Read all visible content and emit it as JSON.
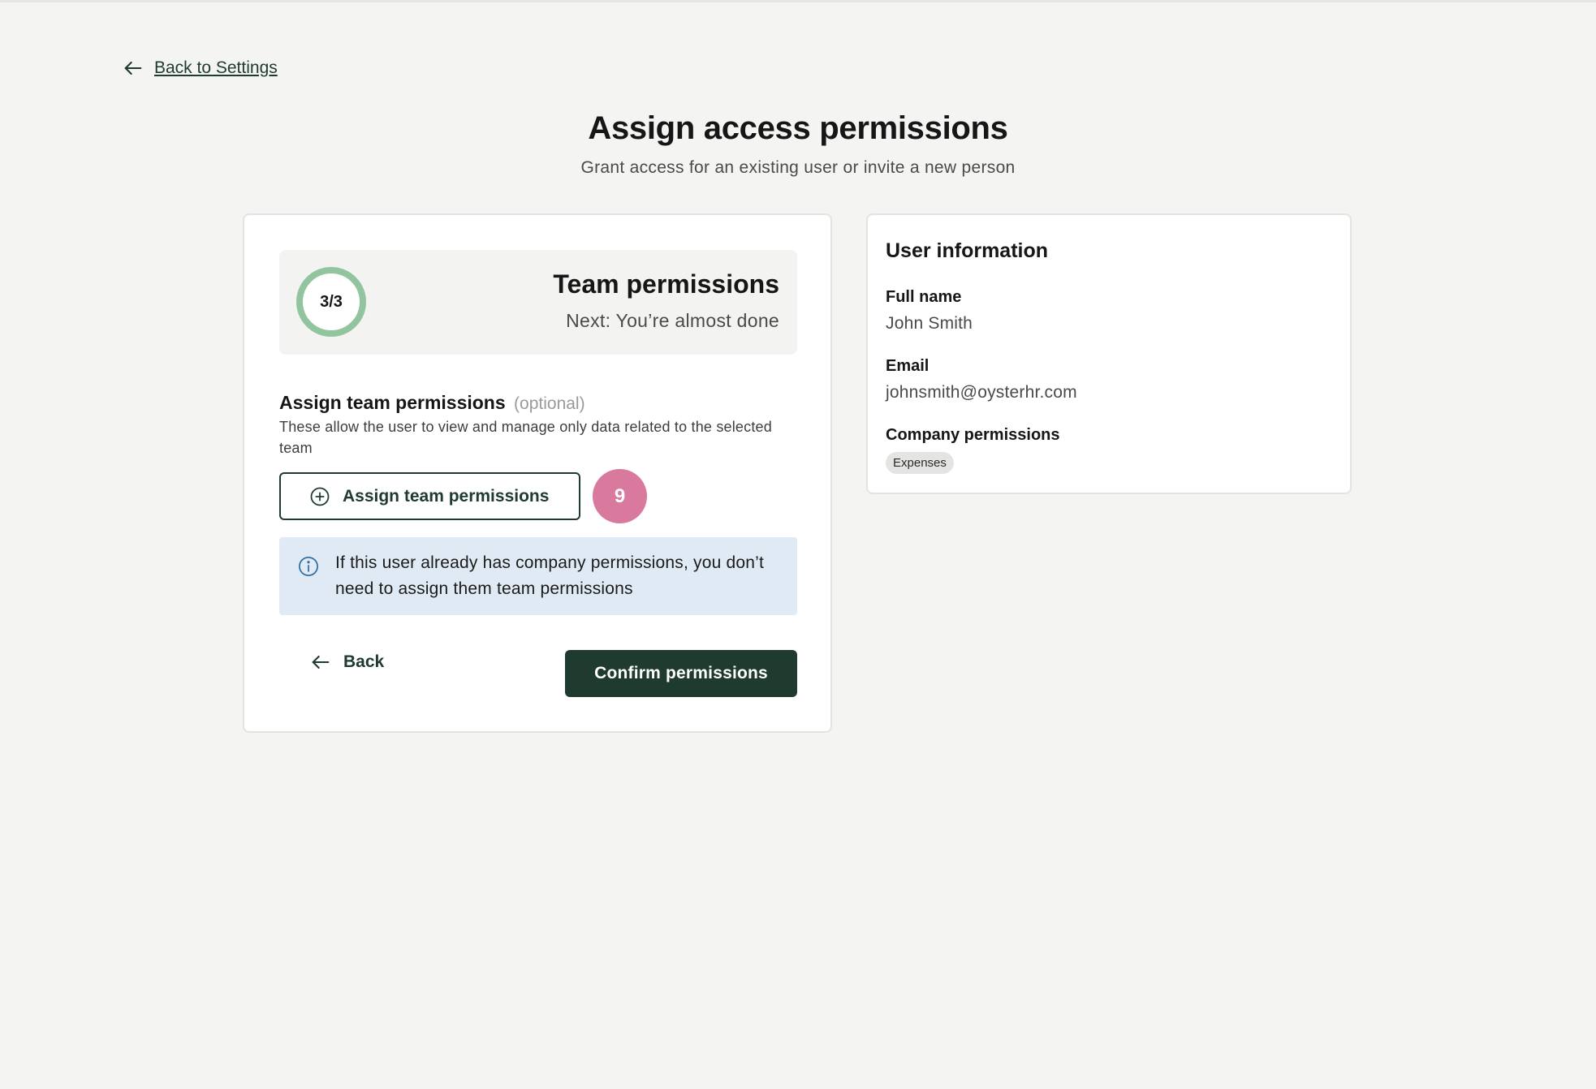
{
  "nav": {
    "back_to_settings": "Back to Settings"
  },
  "header": {
    "title": "Assign access permissions",
    "subtitle": "Grant access for an existing user or invite a new person"
  },
  "step": {
    "progress": "3/3",
    "current": 3,
    "total": 3,
    "title": "Team permissions",
    "next": "Next: You’re almost done"
  },
  "team_permissions": {
    "heading": "Assign team permissions",
    "optional_label": "(optional)",
    "description": "These allow the user to view and manage only data related to the selected team",
    "assign_button": "Assign team permissions",
    "badge_count": "9"
  },
  "info_note": {
    "text": "If this user already has company permissions, you don’t need to assign them team permissions"
  },
  "actions": {
    "back": "Back",
    "confirm": "Confirm permissions"
  },
  "user_info": {
    "title": "User information",
    "full_name_label": "Full name",
    "full_name": "John Smith",
    "email_label": "Email",
    "email": "johnsmith@oysterhr.com",
    "company_permissions_label": "Company permissions",
    "company_permissions": [
      "Expenses"
    ]
  },
  "colors": {
    "background": "#f4f4f3",
    "primary": "#1f3a2e",
    "progress_ring": "#93c4a0",
    "badge": "#d9799e",
    "info_bg": "#dfeaf4",
    "info_icon": "#2f6ea3"
  },
  "icons": {
    "back_link": "arrow-left-icon",
    "assign": "plus-circle-icon",
    "info": "info-icon",
    "back_button": "arrow-left-icon"
  }
}
